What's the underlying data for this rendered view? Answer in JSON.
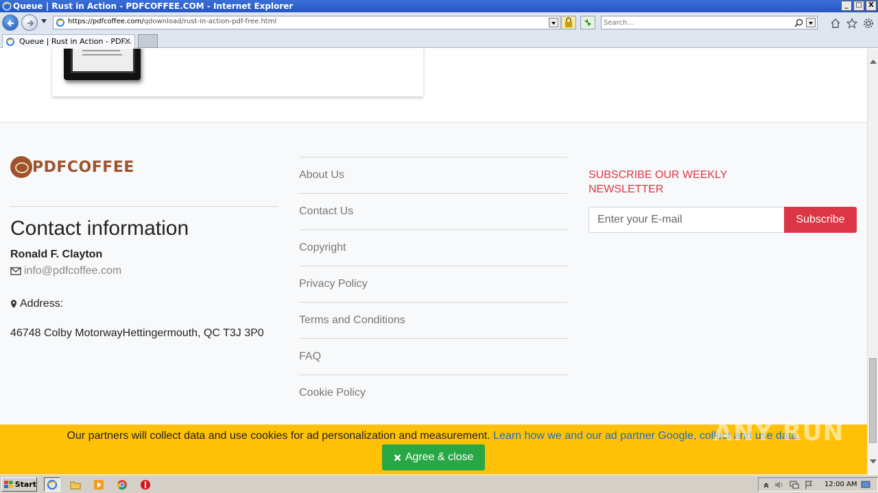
{
  "window": {
    "title": "Queue | Rust in Action - PDFCOFFEE.COM - Internet Explorer",
    "controls": [
      "_",
      "□",
      "X"
    ]
  },
  "address_bar": {
    "url_main": "https://pdfcoffee.com/",
    "url_path": "qdownload/rust-in-action-pdf-free.html"
  },
  "search": {
    "placeholder": "Search..."
  },
  "tab": {
    "label": "Queue | Rust in Action - PDF..."
  },
  "footer": {
    "logo_text": "PDFCOFFEE",
    "contact": {
      "title": "Contact information",
      "name": "Ronald F. Clayton",
      "email": "info@pdfcoffee.com",
      "address_label": "Address:",
      "address": "46748 Colby MotorwayHettingermouth, QC T3J 3P0"
    },
    "links": [
      "About Us",
      "Contact Us",
      "Copyright",
      "Privacy Policy",
      "Terms and Conditions",
      "FAQ",
      "Cookie Policy"
    ],
    "newsletter": {
      "title": "SUBSCRIBE OUR WEEKLY NEWSLETTER",
      "email_placeholder": "Enter your E-mail",
      "button": "Subscribe"
    }
  },
  "cookie_bar": {
    "text": "Our partners will collect data and use cookies for ad personalization and measurement.",
    "link": "Learn how we and our ad partner Google, collect and use data",
    "button": "Agree & close"
  },
  "watermark": "ANY RUN",
  "taskbar": {
    "start": "Start",
    "clock": "12:00 AM"
  },
  "colors": {
    "accent_red": "#dc3545",
    "cookie_yellow": "#ffc107",
    "agree_green": "#28a745",
    "logo_brown": "#a0522d"
  }
}
